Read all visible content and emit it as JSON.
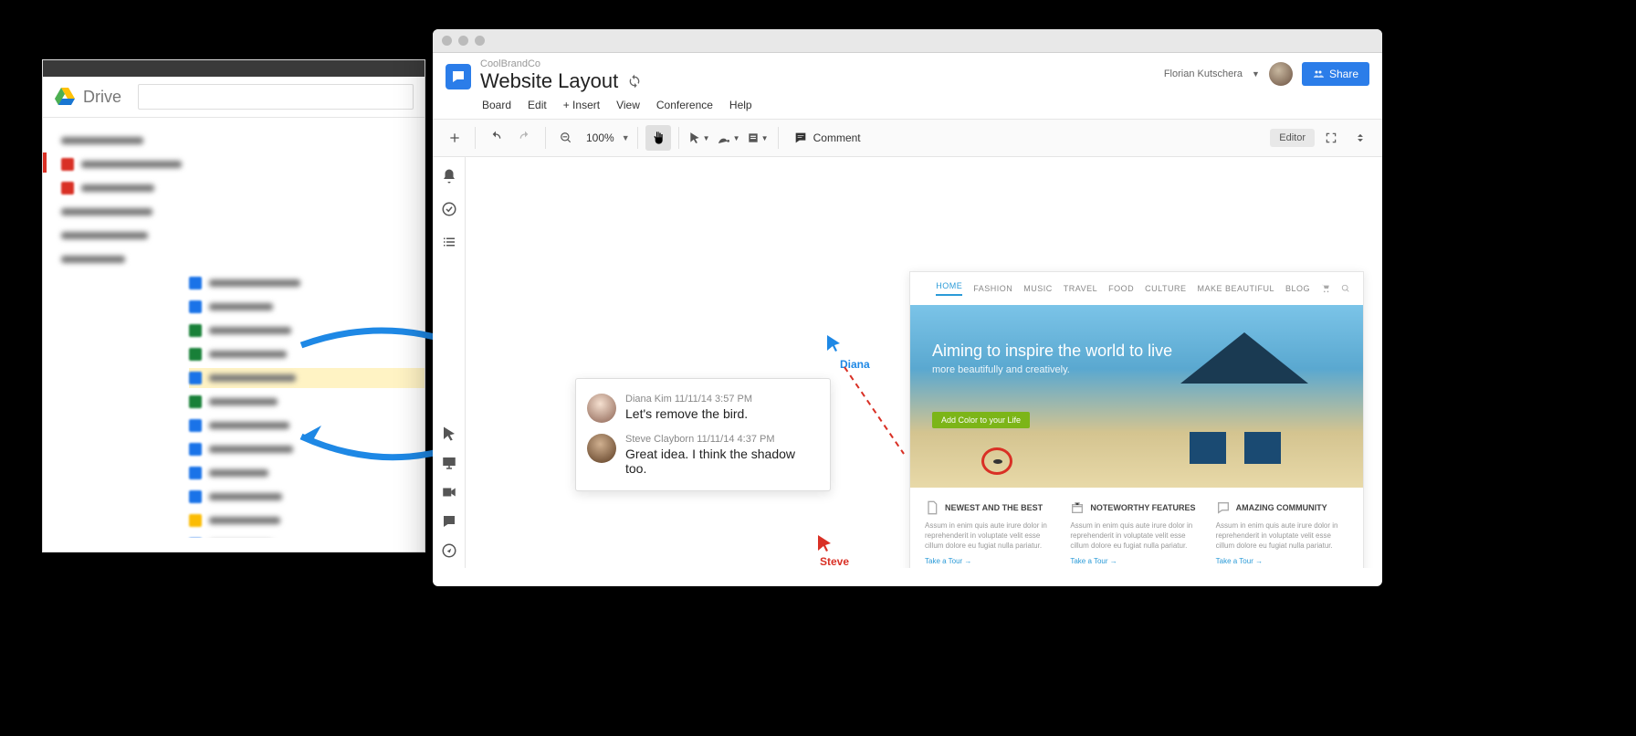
{
  "drive": {
    "title": "Drive"
  },
  "app": {
    "breadcrumb": "CoolBrandCo",
    "title": "Website Layout",
    "user": "Florian Kutschera",
    "share_label": "Share",
    "menu": {
      "board": "Board",
      "edit": "Edit",
      "insert": "+ Insert",
      "view": "View",
      "conference": "Conference",
      "help": "Help"
    },
    "toolbar": {
      "zoom": "100%",
      "comment_label": "Comment",
      "mode": "Editor"
    }
  },
  "cursors": {
    "diana": "Diana",
    "steve": "Steve"
  },
  "comments": [
    {
      "author": "Diana Kim",
      "time": "11/11/14 3:57 PM",
      "text": "Let's remove the bird."
    },
    {
      "author": "Steve Clayborn",
      "time": "11/11/14 4:37 PM",
      "text": "Great idea. I think the shadow too."
    }
  ],
  "mock": {
    "nav": {
      "home": "HOME",
      "fashion": "FASHION",
      "music": "MUSIC",
      "travel": "TRAVEL",
      "food": "FOOD",
      "culture": "CULTURE",
      "make_beautiful": "MAKE BEAUTIFUL",
      "blog": "BLOG"
    },
    "hero_title": "Aiming to inspire the world to live",
    "hero_sub": "more beautifully and creatively.",
    "cta": "Add Color to your Life",
    "cards": [
      {
        "title": "NEWEST AND THE BEST",
        "body": "Assum in enim quis aute irure dolor in reprehenderit in voluptate velit esse cillum dolore eu fugiat nulla pariatur.",
        "link": "Take a Tour →"
      },
      {
        "title": "NOTEWORTHY FEATURES",
        "body": "Assum in enim quis aute irure dolor in reprehenderit in voluptate velit esse cillum dolore eu fugiat nulla pariatur.",
        "link": "Take a Tour →"
      },
      {
        "title": "AMAZING COMMUNITY",
        "body": "Assum in enim quis aute irure dolor in reprehenderit in voluptate velit esse cillum dolore eu fugiat nulla pariatur.",
        "link": "Take a Tour →"
      }
    ]
  }
}
